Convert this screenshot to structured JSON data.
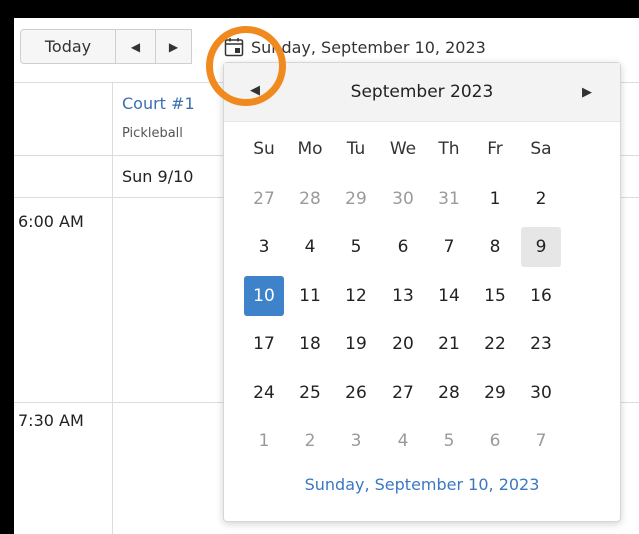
{
  "toolbar": {
    "today_label": "Today",
    "prev_symbol": "◀",
    "next_symbol": "▶",
    "date_text": "Sunday, September 10, 2023",
    "calendar_icon": "calendar-icon"
  },
  "resource": {
    "name": "Court #1",
    "type": "Pickleball",
    "day_label": "Sun 9/10"
  },
  "times": [
    "6:00 AM",
    "7:30 AM"
  ],
  "datepicker": {
    "month_title": "September 2023",
    "prev_symbol": "◀",
    "next_symbol": "▶",
    "weekdays": [
      "Su",
      "Mo",
      "Tu",
      "We",
      "Th",
      "Fr",
      "Sa"
    ],
    "weeks": [
      [
        "27",
        "28",
        "29",
        "30",
        "31",
        "1",
        "2"
      ],
      [
        "3",
        "4",
        "5",
        "6",
        "7",
        "8",
        "9"
      ],
      [
        "10",
        "11",
        "12",
        "13",
        "14",
        "15",
        "16"
      ],
      [
        "17",
        "18",
        "19",
        "20",
        "21",
        "22",
        "23"
      ],
      [
        "24",
        "25",
        "26",
        "27",
        "28",
        "29",
        "30"
      ],
      [
        "1",
        "2",
        "3",
        "4",
        "5",
        "6",
        "7"
      ]
    ],
    "muted_days": [
      [
        0,
        0
      ],
      [
        0,
        1
      ],
      [
        0,
        2
      ],
      [
        0,
        3
      ],
      [
        0,
        4
      ],
      [
        5,
        0
      ],
      [
        5,
        1
      ],
      [
        5,
        2
      ],
      [
        5,
        3
      ],
      [
        5,
        4
      ],
      [
        5,
        5
      ],
      [
        5,
        6
      ]
    ],
    "today_cell": [
      1,
      6
    ],
    "selected_cell": [
      2,
      0
    ],
    "footer_text": "Sunday, September 10, 2023"
  },
  "colors": {
    "accent": "#3e82c9",
    "highlight": "#f08a1e",
    "today_bg": "#e6e6e6"
  }
}
